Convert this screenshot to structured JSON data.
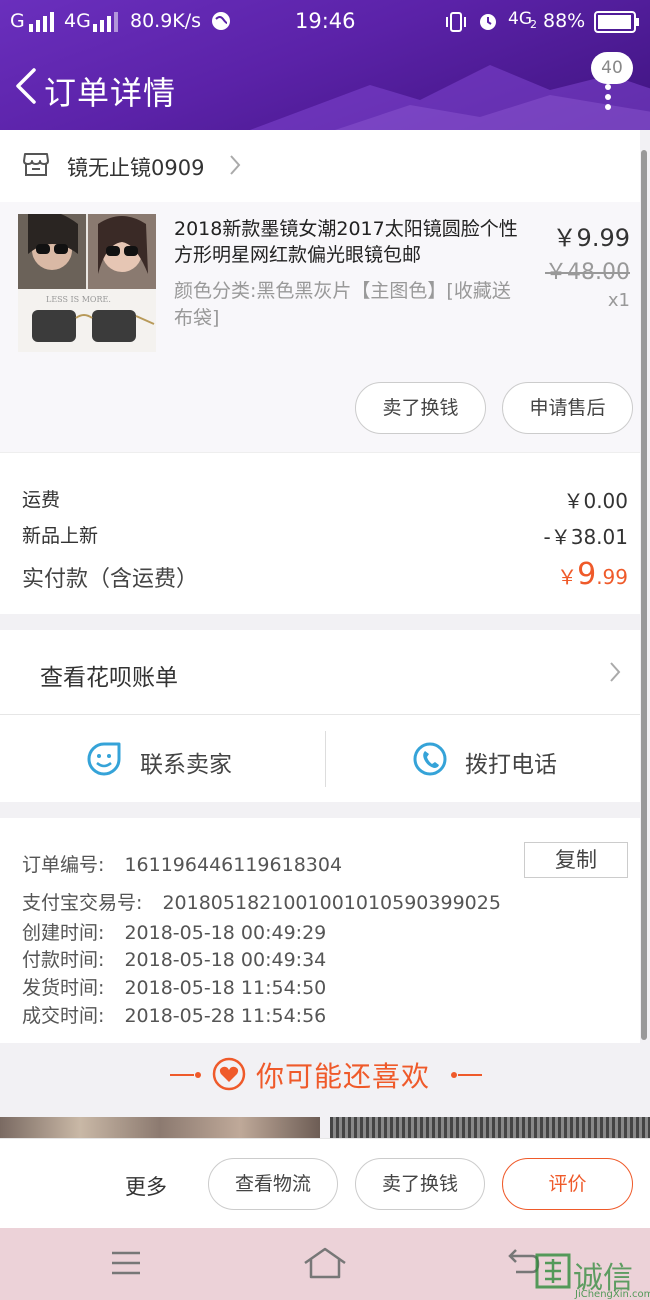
{
  "status": {
    "signal_left": "G",
    "network": "4G",
    "speed": "80.9K/s",
    "time": "19:46",
    "network2": "4G",
    "network2_sub": "2",
    "battery": "88%"
  },
  "header": {
    "title": "订单详情",
    "badge_count": "40"
  },
  "store": {
    "name": "镜无止镜0909"
  },
  "product": {
    "title": "2018新款墨镜女潮2017太阳镜圆脸个性方形明星网红款偏光眼镜包邮",
    "spec": "颜色分类:黑色黑灰片【主图色】[收藏送布袋]",
    "price": "￥9.99",
    "original_price": "￥48.00",
    "quantity": "x1",
    "thumb_caption": "LESS IS MORE.",
    "btn_sell": "卖了换钱",
    "btn_aftersale": "申请售后"
  },
  "fees": {
    "shipping_label": "运费",
    "shipping_value": "￥0.00",
    "promo_label": "新品上新",
    "promo_value": "-￥38.01",
    "paid_label": "实付款（含运费）",
    "paid_currency": "￥",
    "paid_integer": "9",
    "paid_decimal": ".99"
  },
  "huabei": {
    "label": "查看花呗账单"
  },
  "contact": {
    "seller": "联系卖家",
    "phone": "拨打电话"
  },
  "order_info": {
    "order_no_label": "订单编号:",
    "order_no": "161196446119618304",
    "copy": "复制",
    "alipay_label": "支付宝交易号:",
    "alipay_no": "2018051821001001010590399025",
    "created_label": "创建时间:",
    "created": "2018-05-18 00:49:29",
    "paid_label": "付款时间:",
    "paid": "2018-05-18 00:49:34",
    "shipped_label": "发货时间:",
    "shipped": "2018-05-18 11:54:50",
    "done_label": "成交时间:",
    "done": "2018-05-28 11:54:56"
  },
  "recommend": {
    "title": "你可能还喜欢"
  },
  "bottom_bar": {
    "more": "更多",
    "logistics": "查看物流",
    "sell": "卖了换钱",
    "review": "评价"
  },
  "watermark": {
    "text": "诚信",
    "sub": "JiChengXin.com"
  },
  "colors": {
    "header_purple": "#5b22a8",
    "accent_orange": "#ef5a2a",
    "icon_blue": "#35a3d8"
  },
  "icons": [
    "back-icon",
    "more-vertical-icon",
    "store-icon",
    "chevron-right-icon",
    "smile-chat-icon",
    "phone-icon",
    "heart-icon",
    "menu-icon",
    "home-icon",
    "back-nav-icon"
  ]
}
